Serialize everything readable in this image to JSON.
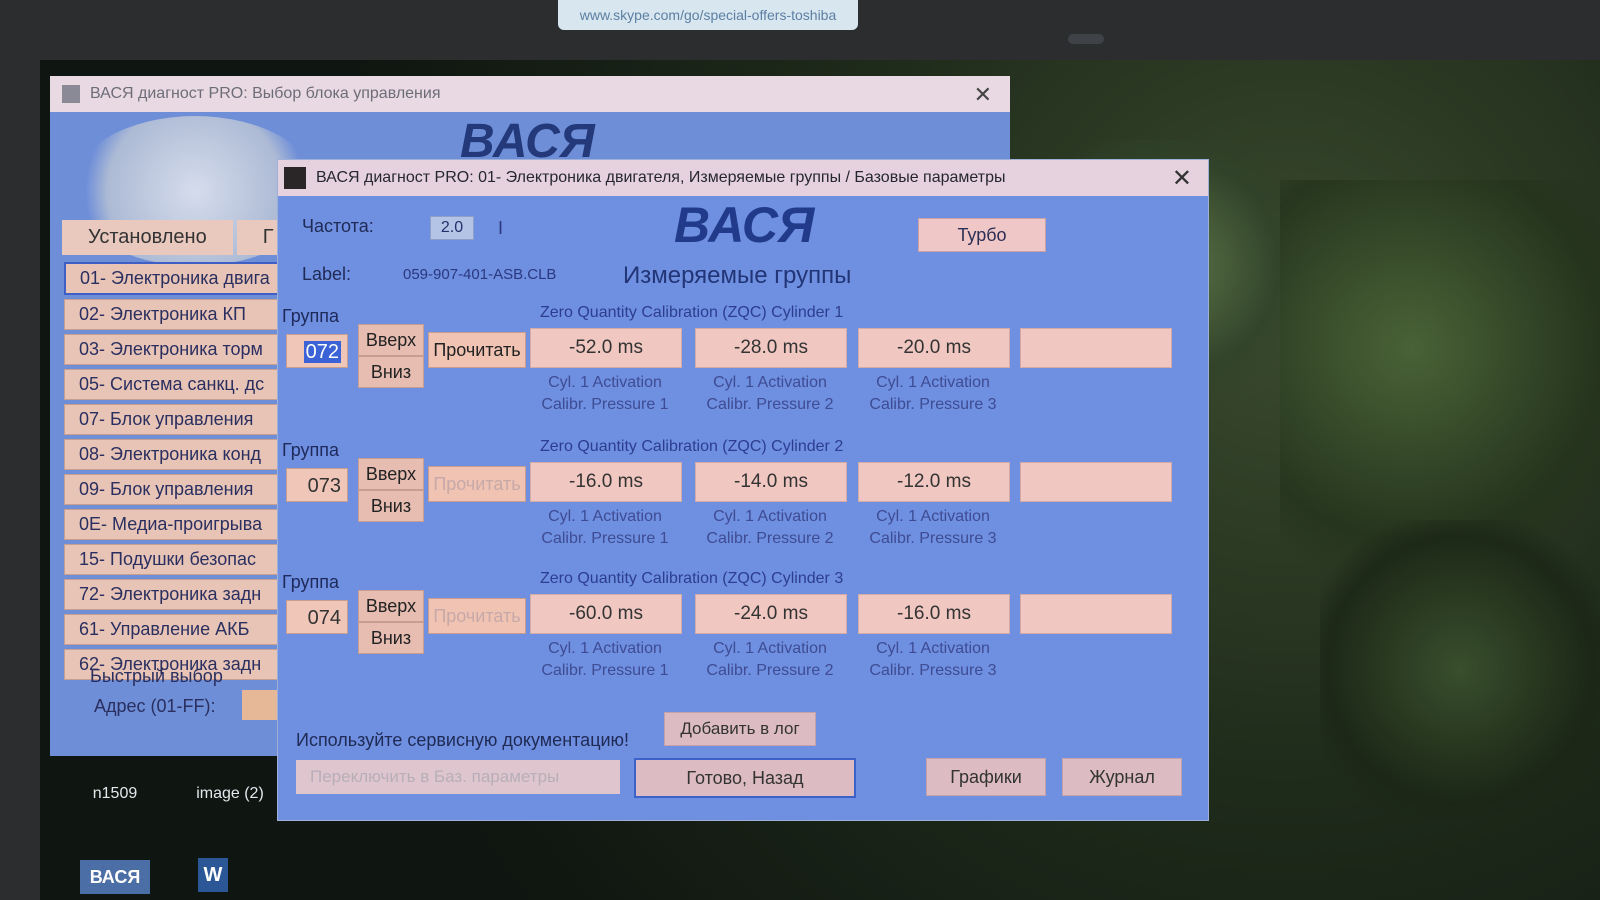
{
  "screen": {
    "sticker_text": "www.skype.com/go/special-offers-toshiba",
    "desktop_icons": [
      "n1509",
      "image (2)",
      "ВАСЯ",
      "W"
    ]
  },
  "back_window": {
    "title": "ВАСЯ диагност PRO:  Выбор блока управления",
    "close": "✕",
    "brand": "ВАСЯ",
    "tabs": [
      "Установлено",
      "Г"
    ],
    "items": [
      "01- Электроника двига",
      "02- Электроника КП",
      "03- Электроника торм",
      "05- Система санкц. дс",
      "07- Блок управления",
      "08- Электроника конд",
      "09- Блок управления",
      "0Е- Медиа-проигрыва",
      "15- Подушки безопас",
      "72- Электроника задн",
      "61- Управление АКБ",
      "62- Электроника задн"
    ],
    "quick_select": "Быстрый выбор",
    "address_label": "Адрес (01-FF):"
  },
  "front_window": {
    "title": "ВАСЯ диагност PRO: 01- Электроника двигателя,  Измеряемые группы / Базовые параметры",
    "close": "✕",
    "freq_label": "Частота:",
    "freq_value": "2.0",
    "freq_tick": "I",
    "label_label": "Label:",
    "label_value": "059-907-401-ASB.CLB",
    "brand": "ВАСЯ",
    "mode_title": "Измеряемые группы",
    "turbo": "Турбо",
    "group_label": "Группа",
    "up": "Вверх",
    "down": "Вниз",
    "read": "Прочитать",
    "groups": [
      {
        "number": "072",
        "title": "Zero Quantity Calibration (ZQC) Cylinder 1",
        "values": [
          "-52.0 ms",
          "-28.0 ms",
          "-20.0 ms",
          ""
        ],
        "captions": [
          [
            "Cyl. 1 Activation",
            "Calibr. Pressure 1"
          ],
          [
            "Cyl. 1 Activation",
            "Calibr. Pressure 2"
          ],
          [
            "Cyl. 1 Activation",
            "Calibr. Pressure 3"
          ]
        ]
      },
      {
        "number": "073",
        "title": "Zero Quantity Calibration (ZQC) Cylinder 2",
        "values": [
          "-16.0 ms",
          "-14.0 ms",
          "-12.0 ms",
          ""
        ],
        "captions": [
          [
            "Cyl. 1 Activation",
            "Calibr. Pressure 1"
          ],
          [
            "Cyl. 1 Activation",
            "Calibr. Pressure 2"
          ],
          [
            "Cyl. 1 Activation",
            "Calibr. Pressure 3"
          ]
        ]
      },
      {
        "number": "074",
        "title": "Zero Quantity Calibration (ZQC) Cylinder 3",
        "values": [
          "-60.0 ms",
          "-24.0 ms",
          "-16.0 ms",
          ""
        ],
        "captions": [
          [
            "Cyl. 1 Activation",
            "Calibr. Pressure 1"
          ],
          [
            "Cyl. 1 Activation",
            "Calibr. Pressure 2"
          ],
          [
            "Cyl. 1 Activation",
            "Calibr. Pressure 3"
          ]
        ]
      }
    ],
    "doc_text": "Используйте сервисную документацию!",
    "add_log": "Добавить в лог",
    "switch_basic": "Переключить в Баз. параметры",
    "done_back": "Готово, Назад",
    "graphs": "Графики",
    "journal": "Журнал"
  }
}
